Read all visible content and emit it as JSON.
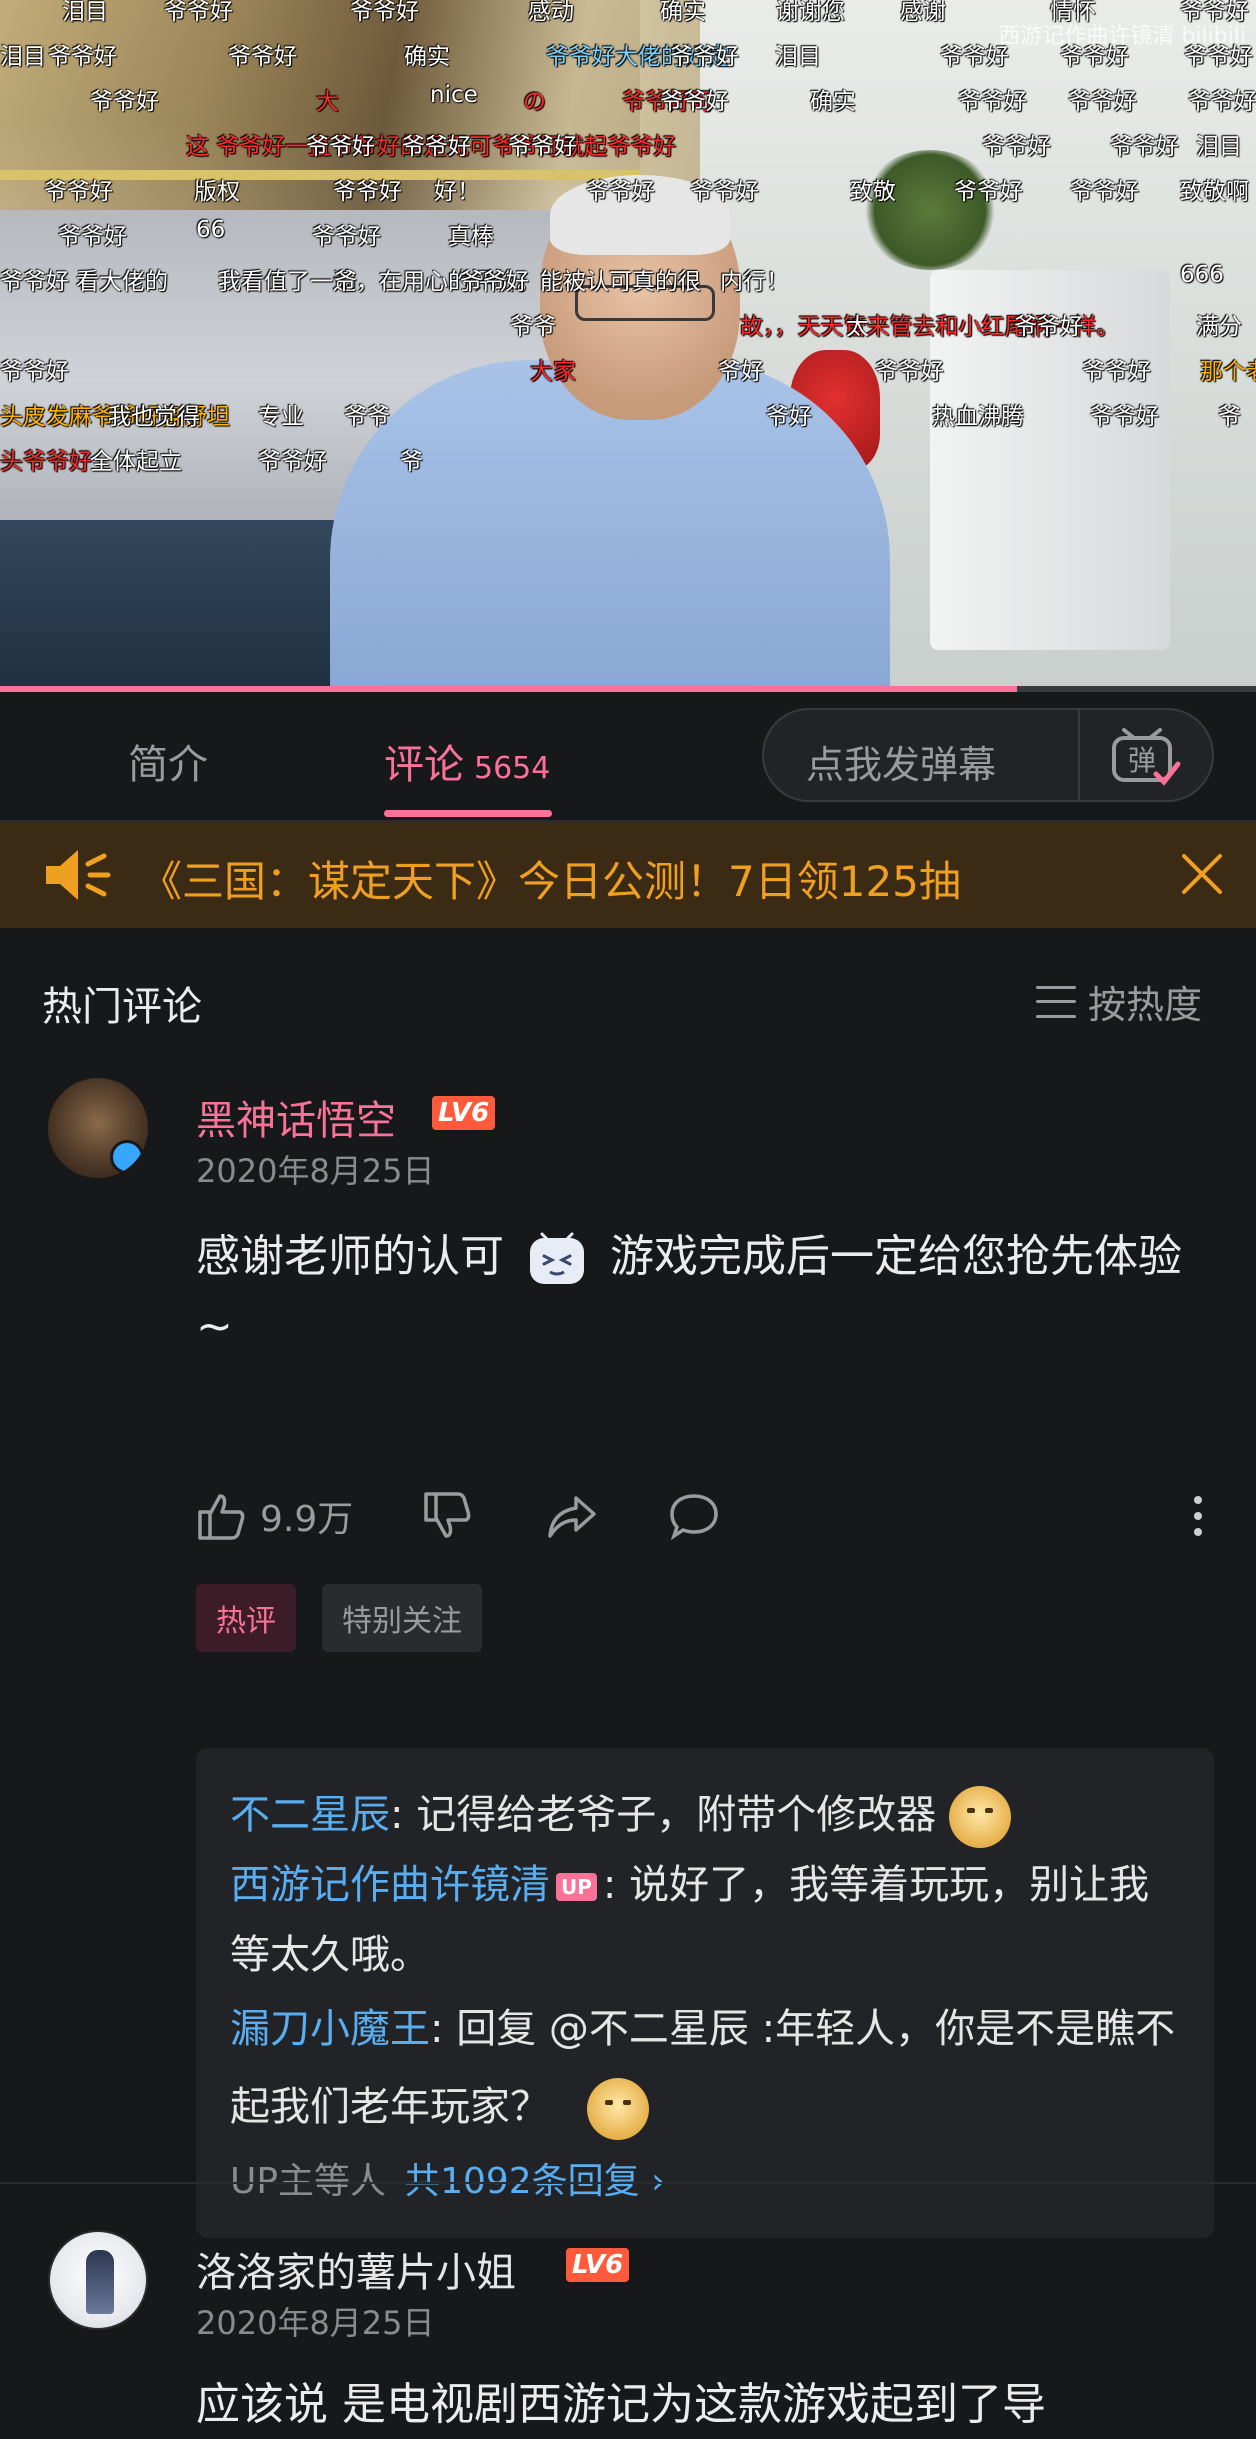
{
  "video": {
    "watermark": "西游记作曲许镜清 bilibili",
    "progress": 0.81,
    "danmaku": [
      {
        "text": "泪目",
        "color": "white"
      },
      {
        "text": "爷爷好",
        "color": "white"
      },
      {
        "text": "爷爷好",
        "color": "white"
      },
      {
        "text": "感动",
        "color": "white"
      },
      {
        "text": "确实",
        "color": "white"
      },
      {
        "text": "谢谢您",
        "color": "white"
      },
      {
        "text": "感谢",
        "color": "white"
      },
      {
        "text": "情怀",
        "color": "white"
      },
      {
        "text": "爷爷好",
        "color": "white"
      },
      {
        "text": "爷爷好",
        "color": "white"
      },
      {
        "text": "爷爷好",
        "color": "white"
      },
      {
        "text": "确实",
        "color": "white"
      },
      {
        "text": "爷爷好大佬的好定",
        "color": "blue"
      },
      {
        "text": "爷爷好",
        "color": "white"
      },
      {
        "text": "泪目",
        "color": "white"
      },
      {
        "text": "爷爷好",
        "color": "white"
      },
      {
        "text": "爷爷好",
        "color": "white"
      },
      {
        "text": "爷爷好",
        "color": "white"
      },
      {
        "text": "泪目",
        "color": "white"
      },
      {
        "text": "爷爷好",
        "color": "white"
      },
      {
        "text": "大",
        "color": "red"
      },
      {
        "text": "nice",
        "color": "white"
      },
      {
        "text": "の",
        "color": "red"
      },
      {
        "text": "爷爷好可",
        "color": "red"
      },
      {
        "text": "爷爷好",
        "color": "white"
      },
      {
        "text": "确实",
        "color": "white"
      },
      {
        "text": "爷爷好",
        "color": "white"
      },
      {
        "text": "爷爷好",
        "color": "white"
      },
      {
        "text": "爷爷好",
        "color": "white"
      },
      {
        "text": "这 爷爷好一直爷爷好的是无可爷爷好就起爷爷好",
        "color": "red"
      },
      {
        "text": "爷爷好",
        "color": "white"
      },
      {
        "text": "爷爷好",
        "color": "white"
      },
      {
        "text": "爷爷好",
        "color": "white"
      },
      {
        "text": "爷爷好",
        "color": "white"
      },
      {
        "text": "爷爷好",
        "color": "white"
      },
      {
        "text": "泪目",
        "color": "white"
      },
      {
        "text": "爷爷好",
        "color": "white"
      },
      {
        "text": "版权",
        "color": "white"
      },
      {
        "text": "爷爷好",
        "color": "white"
      },
      {
        "text": "好！",
        "color": "white"
      },
      {
        "text": "爷爷好",
        "color": "white"
      },
      {
        "text": "爷爷好",
        "color": "white"
      },
      {
        "text": "致敬",
        "color": "white"
      },
      {
        "text": "爷爷好",
        "color": "white"
      },
      {
        "text": "爷爷好",
        "color": "white"
      },
      {
        "text": "致敬啊",
        "color": "white"
      },
      {
        "text": "爷爷好",
        "color": "white"
      },
      {
        "text": "66",
        "color": "white"
      },
      {
        "text": "爷爷好",
        "color": "white"
      },
      {
        "text": "真棒",
        "color": "white"
      },
      {
        "text": "爷爷好",
        "color": "white"
      },
      {
        "text": "看大佬的",
        "color": "white"
      },
      {
        "text": "我看值了一遍，在用心的评价。能被认可真的很",
        "color": "white"
      },
      {
        "text": "爷",
        "color": "white"
      },
      {
        "text": "爷爷好",
        "color": "white"
      },
      {
        "text": "内行！",
        "color": "white"
      },
      {
        "text": "666",
        "color": "white"
      },
      {
        "text": "爷爷",
        "color": "white"
      },
      {
        "text": "故，，天天管来管去和小红尾柄一样。",
        "color": "red"
      },
      {
        "text": "太",
        "color": "white"
      },
      {
        "text": "爷爷好",
        "color": "white"
      },
      {
        "text": "满分",
        "color": "white"
      },
      {
        "text": "爷爷好",
        "color": "white"
      },
      {
        "text": "大家",
        "color": "red"
      },
      {
        "text": "爷好",
        "color": "white"
      },
      {
        "text": "爷爷好",
        "color": "white"
      },
      {
        "text": "爷爷好",
        "color": "white"
      },
      {
        "text": "那个老猴子呀",
        "color": "yellow"
      },
      {
        "text": "头皮发麻爷爷好身舒坦",
        "color": "yellow"
      },
      {
        "text": "我也觉得",
        "color": "white"
      },
      {
        "text": "专业",
        "color": "white"
      },
      {
        "text": "爷爷",
        "color": "white"
      },
      {
        "text": "爷好",
        "color": "white"
      },
      {
        "text": "热血沸腾",
        "color": "white"
      },
      {
        "text": "爷爷好",
        "color": "white"
      },
      {
        "text": "爷",
        "color": "white"
      },
      {
        "text": "头爷爷好",
        "color": "red"
      },
      {
        "text": "全体起立",
        "color": "white"
      },
      {
        "text": "爷爷好",
        "color": "white"
      },
      {
        "text": "爷",
        "color": "white"
      }
    ]
  },
  "tabs": {
    "intro": "简介",
    "comments": "评论",
    "comments_count": "5654",
    "danmaku_placeholder": "点我发弹幕",
    "danmaku_toggle": "弹"
  },
  "ad": {
    "text": "《三国：谋定天下》今日公测！7日领125抽"
  },
  "hot": {
    "title": "热门评论",
    "sort": "按热度"
  },
  "comments": [
    {
      "user": "黑神话悟空",
      "level": "LV6",
      "date": "2020年8月25日",
      "text_a": "感谢老师的认可",
      "emoji": "(>_<)",
      "text_b": "游戏完成后一定给您抢先体验~",
      "likes": "9.9万",
      "tags": [
        "热评",
        "特别关注"
      ],
      "replies": [
        {
          "name": "不二星辰",
          "text": ": 记得给老爷子，附带个修改器"
        },
        {
          "name": "西游记作曲许镜清",
          "badge": "UP",
          "text": ": 说好了，我等着玩玩，别让我等太久哦。"
        },
        {
          "name": "漏刀小魔王",
          "text": ": 回复 @不二星辰 :年轻人，你是不是瞧不起我们老年玩家？"
        }
      ],
      "reply_prefix": "UP主等人",
      "reply_count": "共1092条回复 ›"
    },
    {
      "user": "洛洛家的薯片小姐",
      "level": "LV6",
      "date": "2020年8月25日",
      "text": "应该说 是电视剧西游记为这款游戏起到了导"
    }
  ],
  "colors": {
    "accent": "#fb7299",
    "link": "#58aef0",
    "ad_text": "#f0a020",
    "background": "#17181a"
  }
}
